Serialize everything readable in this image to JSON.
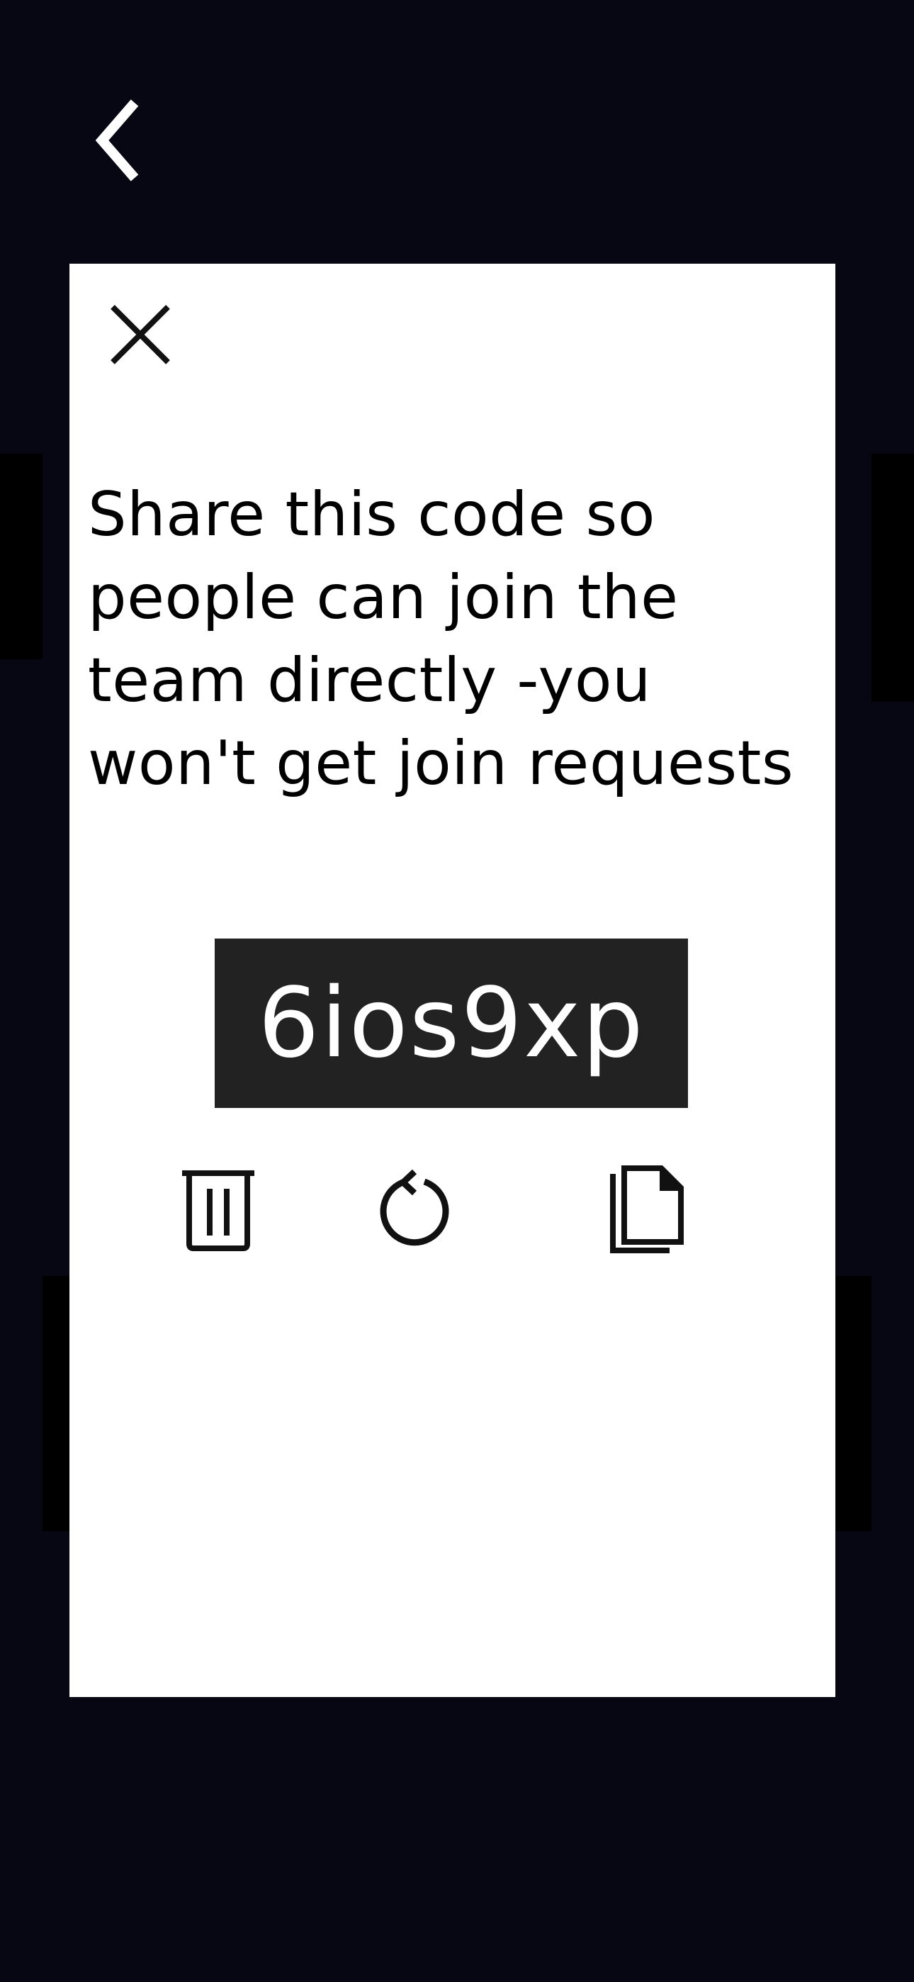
{
  "colors": {
    "screen_background": "#070714",
    "modal_background": "#ffffff",
    "code_background": "#222222",
    "code_text": "#ffffff",
    "icon_stroke": "#111111"
  },
  "icons": {
    "back": "chevron-left-icon",
    "close": "close-icon",
    "delete": "trash-icon",
    "regenerate": "refresh-icon",
    "copy": "copy-icon"
  },
  "modal": {
    "message": "Share this code so people can join the team directly -you won't get join requests",
    "invite_code": "6ios9xp"
  }
}
